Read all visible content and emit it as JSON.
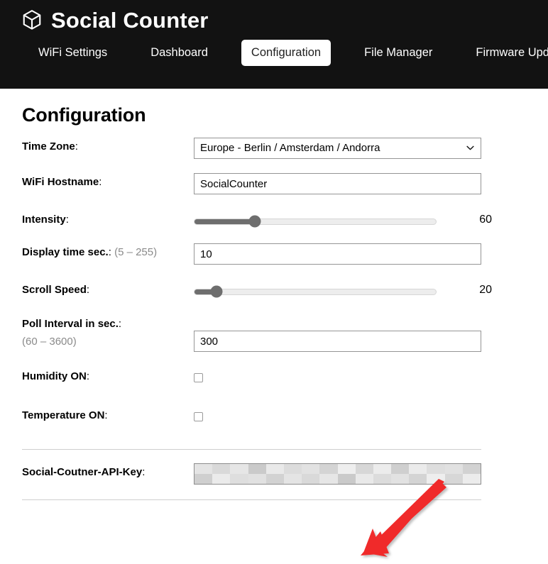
{
  "header": {
    "brand_icon": "cube-box-icon",
    "title": "Social Counter",
    "background_color": "#121212",
    "tabs": [
      {
        "label": "WiFi Settings",
        "active": false
      },
      {
        "label": "Dashboard",
        "active": false
      },
      {
        "label": "Configuration",
        "active": true
      },
      {
        "label": "File Manager",
        "active": false
      },
      {
        "label": "Firmware Update",
        "active": false
      }
    ]
  },
  "page": {
    "title": "Configuration"
  },
  "form": {
    "timezone": {
      "label": "Time Zone",
      "colon": ":",
      "value": "Europe - Berlin / Amsterdam / Andorra",
      "chevron_icon": "chevron-down-icon"
    },
    "hostname": {
      "label": "WiFi Hostname",
      "colon": ":",
      "value": "SocialCounter",
      "placeholder": ""
    },
    "intensity": {
      "label": "Intensity",
      "colon": ":",
      "value": "60",
      "percent": 25,
      "track_color": "#ededed",
      "fill_color": "#6e6e6e"
    },
    "display_time": {
      "label": "Display time sec.",
      "colon": ":",
      "hint": "(5 – 255)",
      "value": "10",
      "placeholder": ""
    },
    "scroll_speed": {
      "label": "Scroll Speed",
      "colon": ":",
      "value": "20",
      "percent": 9,
      "track_color": "#ededed",
      "fill_color": "#6e6e6e"
    },
    "poll_interval": {
      "label": "Poll Interval in sec.",
      "colon": ":",
      "hint": "(60 – 3600)",
      "value": "300",
      "placeholder": ""
    },
    "humidity": {
      "label": "Humidity ON",
      "colon": ":",
      "checked": false
    },
    "temperature": {
      "label": "Temperature ON",
      "colon": ":",
      "checked": false
    },
    "api_key": {
      "label": "Social-Coutner-API-Key",
      "colon": ":",
      "value": "",
      "redacted": true
    }
  },
  "annotation": {
    "arrow_color": "#f02b2b",
    "points_to": "api-key-field"
  }
}
